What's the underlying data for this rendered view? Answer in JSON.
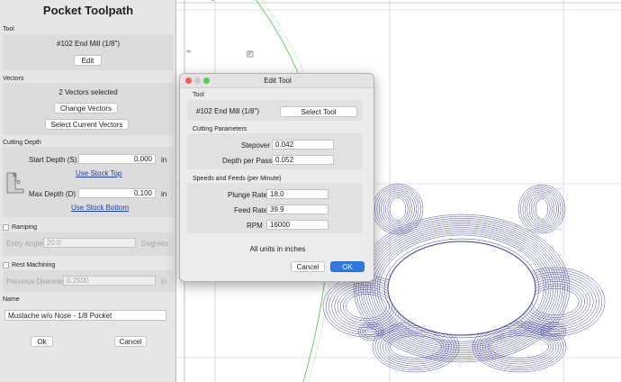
{
  "panel": {
    "title": "Pocket Toolpath",
    "tool": {
      "section": "Tool",
      "name": "#102 End Mill (1/8\")",
      "edit_label": "Edit"
    },
    "vectors": {
      "section": "Vectors",
      "status": "2 Vectors selected",
      "change_label": "Change Vectors",
      "select_current_label": "Select Current Vectors"
    },
    "cutting_depth": {
      "section": "Cutting Depth",
      "start_label": "Start Depth (S)",
      "start_value": "0.000",
      "start_unit": "in",
      "use_stock_top": "Use Stock Top",
      "max_label": "Max Depth (D)",
      "max_value": "0.100",
      "max_unit": "in",
      "use_stock_bottom": "Use Stock Bottom",
      "diagram_s": "S",
      "diagram_d": "D"
    },
    "ramping": {
      "section": "Ramping",
      "entry_label": "Entry Angle",
      "entry_value": "20.0",
      "entry_unit": "Degrees",
      "checked": false
    },
    "rest": {
      "section": "Rest Machining",
      "diameter_label": "Previous Diameter",
      "diameter_value": "0.2500",
      "diameter_unit": "in",
      "checked": false
    },
    "name": {
      "section": "Name",
      "value": "Mustache w/o Nose - 1/8 Pocket"
    },
    "ok_label": "Ok",
    "cancel_label": "Cancel"
  },
  "canvas": {
    "ruler_v_tick": "0",
    "ruler_h_tick": "0",
    "marker": "Z"
  },
  "dialog": {
    "title": "Edit Tool",
    "tool": {
      "section": "Tool",
      "name": "#102 End Mill (1/8\")",
      "select_label": "Select Tool"
    },
    "cutting": {
      "section": "Cutting Parameters",
      "stepover_label": "Stepover",
      "stepover_value": "0.042",
      "depth_label": "Depth per Pass",
      "depth_value": "0.052"
    },
    "speeds": {
      "section": "Speeds and Feeds (per Minute)",
      "plunge_label": "Plunge Rate",
      "plunge_value": "18.0",
      "feed_label": "Feed Rate",
      "feed_value": "39.9",
      "rpm_label": "RPM",
      "rpm_value": "16000"
    },
    "units_note": "All units in inches",
    "cancel_label": "Cancel",
    "ok_label": "OK"
  },
  "colors": {
    "accent": "#2f79e6",
    "link": "#1f3fb5",
    "toolpath": "#3a3a9a",
    "boundary": "#5cc75c",
    "grid": "#c4c8d8"
  }
}
